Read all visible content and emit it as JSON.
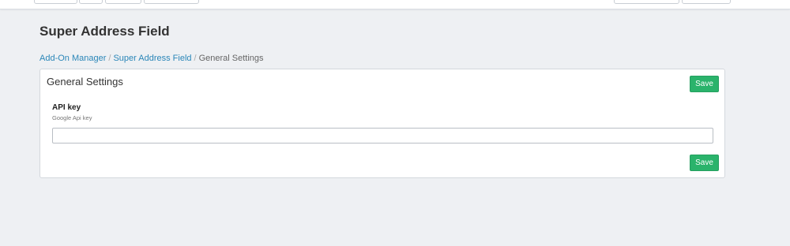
{
  "header": {
    "title": "Super Address Field"
  },
  "breadcrumb": {
    "items": [
      "Add-On Manager",
      "Super Address Field"
    ],
    "current": "General Settings",
    "separator": "/"
  },
  "panel": {
    "title": "General Settings",
    "save_label": "Save",
    "fields": [
      {
        "label": "API key",
        "help": "Google Api key",
        "value": "",
        "placeholder": ""
      }
    ]
  },
  "colors": {
    "save_button": "#2ab36b",
    "link": "#2a86b8",
    "background": "#eef0f3"
  }
}
